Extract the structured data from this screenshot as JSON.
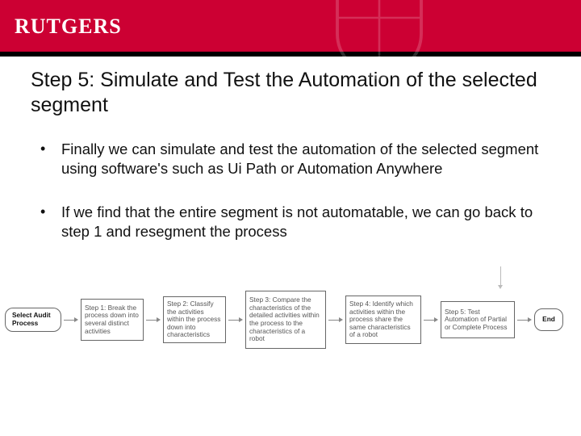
{
  "brand": {
    "logo_text": "RUTGERS"
  },
  "slide": {
    "title": "Step 5: Simulate and Test the Automation of the selected segment",
    "bullets": [
      "Finally we can simulate and test the automation of the selected segment using software's such as Ui Path or Automation Anywhere",
      "If we find that the entire segment is not automatable, we can go back to step 1 and resegment the process"
    ]
  },
  "flow": {
    "start": "Select Audit Process",
    "steps": [
      "Step 1: Break the process down into several distinct activities",
      "Step 2: Classify the activities within the process down into characteristics",
      "Step 3: Compare the characteristics of the detailed activities within the process to the characteristics of a robot",
      "Step 4: Identify which activities within the process share the same characteristics of a robot",
      "Step 5: Test Automation of Partial or Complete Process"
    ],
    "end": "End"
  }
}
